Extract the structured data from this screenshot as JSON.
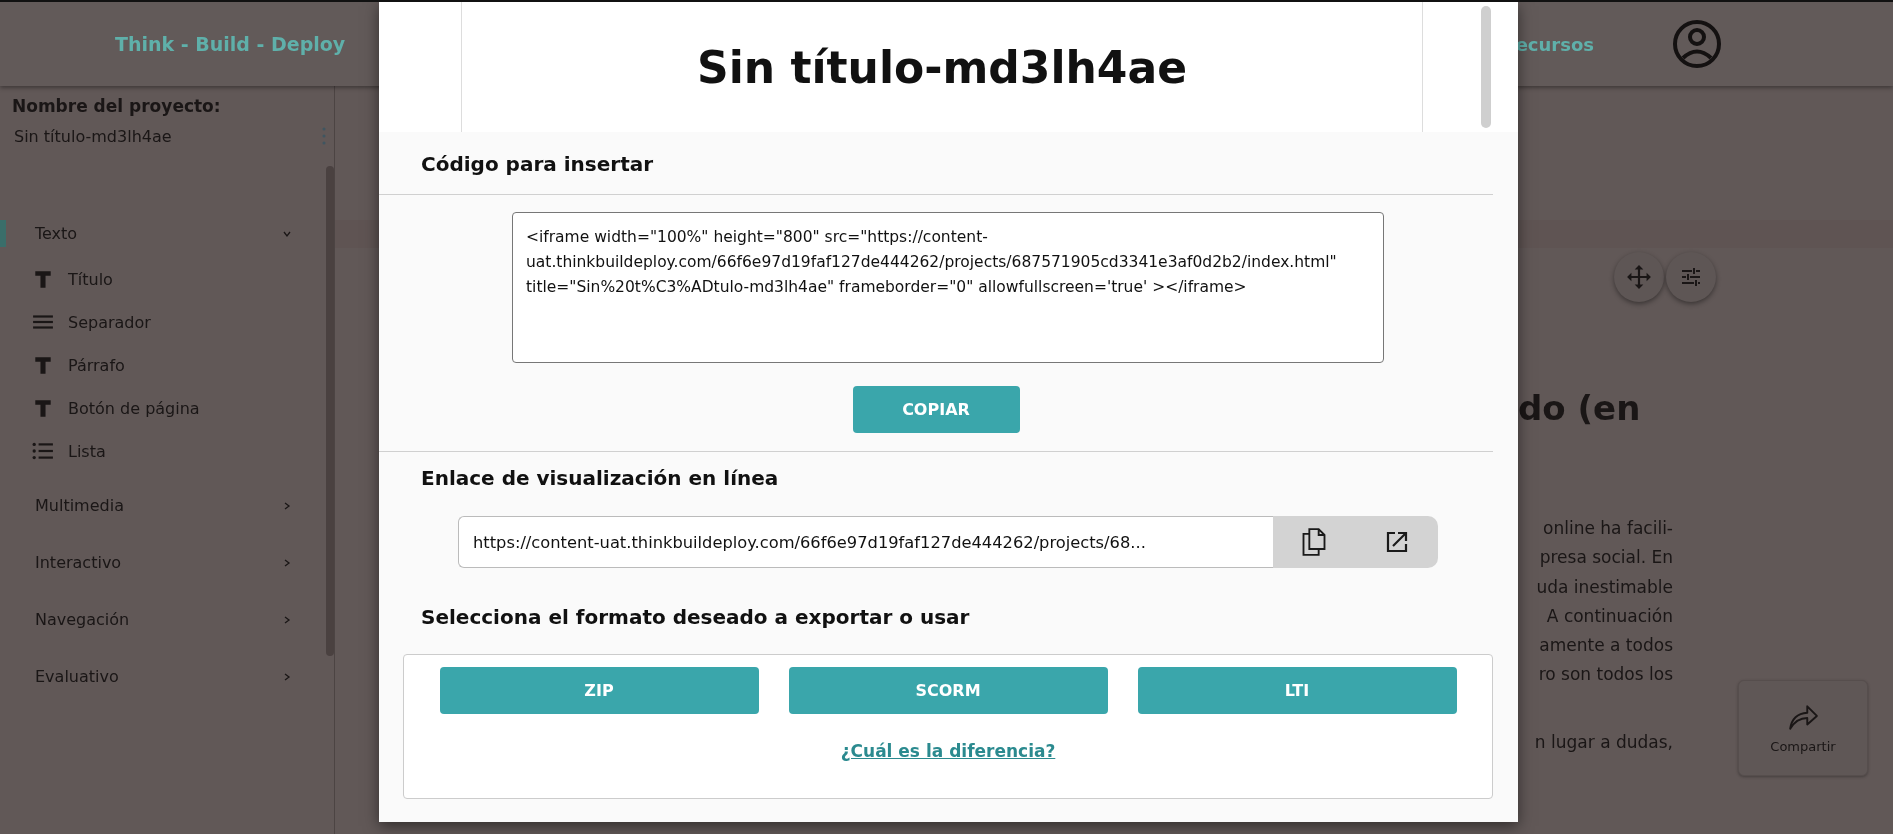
{
  "header": {
    "brand": "Think - Build - Deploy",
    "nav_link": "ecursos"
  },
  "sidebar": {
    "project_label": "Nombre del proyecto:",
    "project_name": "Sin título-md3lh4ae",
    "categories": [
      {
        "label": "Texto",
        "selected": true,
        "expanded": true,
        "children": [
          {
            "label": "Título",
            "kind": "text"
          },
          {
            "label": "Separador",
            "kind": "separator"
          },
          {
            "label": "Párrafo",
            "kind": "text"
          },
          {
            "label": "Botón de página",
            "kind": "text"
          },
          {
            "label": "Lista",
            "kind": "list"
          }
        ]
      },
      {
        "label": "Multimedia",
        "selected": false,
        "expanded": false
      },
      {
        "label": "Interactivo",
        "selected": false,
        "expanded": false
      },
      {
        "label": "Navegación",
        "selected": false,
        "expanded": false
      },
      {
        "label": "Evaluativo",
        "selected": false,
        "expanded": false
      }
    ]
  },
  "canvas": {
    "heading": "do (en",
    "paragraph_lines": [
      "online ha facili-",
      "presa social. En",
      "uda inestimable",
      "A continuación",
      "amente a todos",
      "ro son todos los"
    ],
    "paragraph_tail": "n lugar a dudas,",
    "share_button": "Compartir"
  },
  "modal": {
    "preview_title": "Sin título-md3lh4ae",
    "embed": {
      "title": "Código para insertar",
      "code": "<iframe width=\"100%\" height=\"800\" src=\"https://content-uat.thinkbuildeploy.com/66f6e97d19faf127de444262/projects/687571905cd3341e3af0d2b2/index.html\" title=\"Sin%20t%C3%ADtulo-md3lh4ae\" frameborder=\"0\" allowfullscreen='true' ></iframe>",
      "copy_button": "COPIAR"
    },
    "link": {
      "title": "Enlace de visualización en línea",
      "url": "https://content-uat.thinkbuildeploy.com/66f6e97d19faf127de444262/projects/68..."
    },
    "export": {
      "title": "Selecciona el formato deseado a exportar o usar",
      "formats": [
        "ZIP",
        "SCORM",
        "LTI"
      ],
      "help_link": "¿Cuál es la diferencia?"
    }
  }
}
